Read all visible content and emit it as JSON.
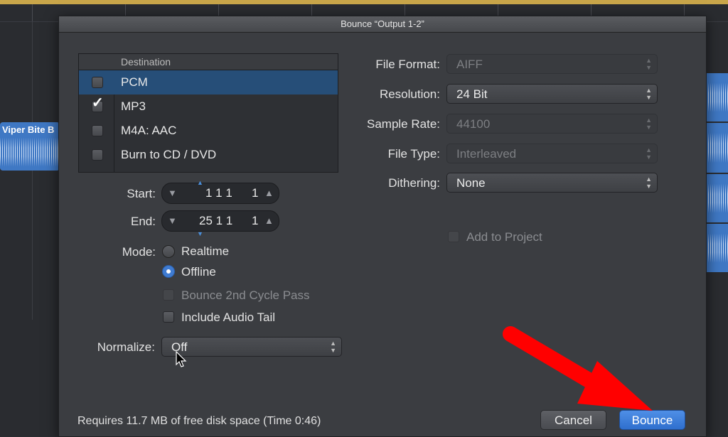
{
  "background": {
    "region_label": "Viper Bite B"
  },
  "dialog": {
    "title": "Bounce “Output 1-2”",
    "destination": {
      "header": "Destination",
      "items": [
        {
          "label": "PCM",
          "checked": false,
          "selected": true
        },
        {
          "label": "MP3",
          "checked": true,
          "selected": false
        },
        {
          "label": "M4A: AAC",
          "checked": false,
          "selected": false
        },
        {
          "label": "Burn to CD / DVD",
          "checked": false,
          "selected": false
        }
      ]
    },
    "start": {
      "label": "Start:",
      "bars": "1 1 1",
      "ticks": "1"
    },
    "end": {
      "label": "End:",
      "bars": "25 1 1",
      "ticks": "1"
    },
    "mode": {
      "label": "Mode:",
      "realtime": "Realtime",
      "offline": "Offline",
      "selected": "Offline"
    },
    "bounce_2nd_cycle": {
      "label": "Bounce 2nd Cycle Pass",
      "checked": false,
      "enabled": false
    },
    "include_audio_tail": {
      "label": "Include Audio Tail",
      "checked": false
    },
    "normalize": {
      "label": "Normalize:",
      "value": "Off"
    },
    "file_format": {
      "label": "File Format:",
      "value": "AIFF",
      "enabled": false
    },
    "resolution": {
      "label": "Resolution:",
      "value": "24 Bit",
      "enabled": true
    },
    "sample_rate": {
      "label": "Sample Rate:",
      "value": "44100",
      "enabled": false
    },
    "file_type": {
      "label": "File Type:",
      "value": "Interleaved",
      "enabled": false
    },
    "dithering": {
      "label": "Dithering:",
      "value": "None",
      "enabled": true
    },
    "add_to_project": {
      "label": "Add to Project",
      "checked": false,
      "enabled": false
    },
    "footer": {
      "disk_space": "Requires 11.7 MB of free disk space  (Time 0:46)",
      "cancel": "Cancel",
      "bounce": "Bounce"
    }
  },
  "colors": {
    "accent": "#3f7bd1",
    "annotation_arrow": "#ff0000"
  }
}
